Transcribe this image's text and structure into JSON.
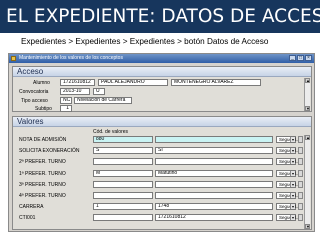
{
  "slide": {
    "title": "EL EXPEDIENTE: DATOS DE ACCESO",
    "subtitle": "Expedientes > Expedientes > Expedientes > botón Datos de Acceso"
  },
  "window": {
    "title": "Mantenimiento de los valores de los conceptos"
  },
  "acceso": {
    "header": "Acceso",
    "alumno_label": "Alumno",
    "alumno_id": "17216108​12",
    "alumno_nombre": "PAUL ALEJANDRO",
    "alumno_apellidos": "MONTENEGRO ALVAREZ",
    "convocatoria_label": "Convocatoria",
    "convocatoria_anio": "2013-10",
    "convocatoria_codigo": "U",
    "tipo_label": "Tipo acceso",
    "tipo_codigo": "NC",
    "tipo_desc": "Nivelación de Carrera",
    "subtipo_label": "Subtipo",
    "subtipo_valor": "1"
  },
  "valores": {
    "header": "Valores",
    "column_header": "Cód. de valores",
    "rows": [
      {
        "label": "NOTA DE ADMISIÓN",
        "code": "880",
        "desc": "",
        "cyan": true,
        "action": "Segue d..."
      },
      {
        "label": "SOLICITA EXONERACIÓN",
        "code": "S",
        "desc": "SI",
        "cyan": false,
        "action": "Segue d..."
      },
      {
        "label": "2ª PREFER. TURNO",
        "code": "",
        "desc": "",
        "cyan": false,
        "action": "Segue d..."
      },
      {
        "label": "1ª PREFER. TURNO",
        "code": "M",
        "desc": "Matutino",
        "cyan": false,
        "action": "Segue d..."
      },
      {
        "label": "3ª PREFER. TURNO",
        "code": "",
        "desc": "",
        "cyan": false,
        "action": "Segue d..."
      },
      {
        "label": "4ª PREFER. TURNO",
        "code": "",
        "desc": "",
        "cyan": false,
        "action": "Segue d..."
      },
      {
        "label": "CARRERA",
        "code": "1",
        "desc": "1748",
        "cyan": false,
        "action": "Segue d..."
      },
      {
        "label": "CTI001",
        "code": "",
        "desc": "1721610812",
        "cyan": false,
        "action": "Segue d..."
      }
    ]
  },
  "icons": {
    "app": "window-app-icon",
    "dropdown": "chevron-down-icon",
    "scroll_up": "scroll-up-icon",
    "scroll_down": "scroll-down-icon"
  },
  "colors": {
    "title_bar": "#17365d",
    "window_title": "#2f5ea7",
    "panel_bg": "#e0ded8",
    "cyan_field": "#c9f3f3"
  }
}
